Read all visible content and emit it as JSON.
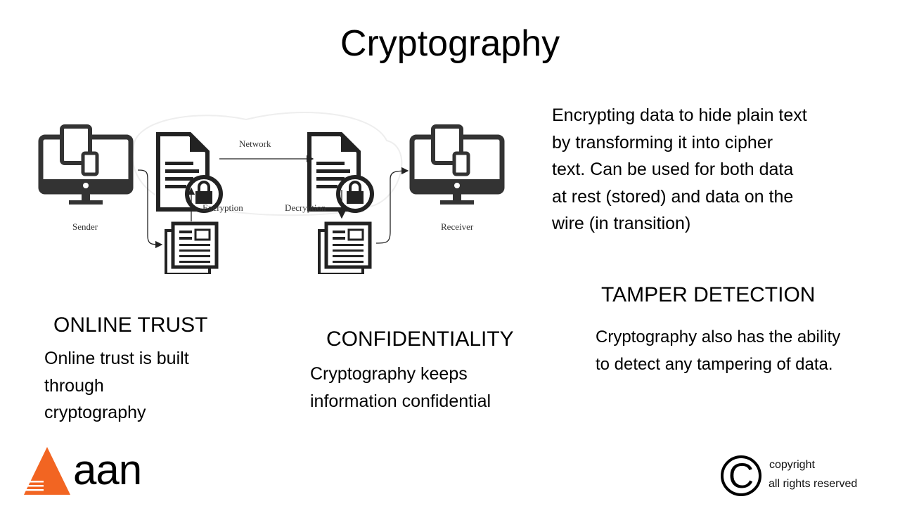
{
  "title": "Cryptography",
  "diagram": {
    "sender": "Sender",
    "receiver": "Receiver",
    "network": "Network",
    "encryption": "Encryption",
    "decryption": "Decryption"
  },
  "description": [
    "Encrypting data to hide plain text",
    "by transforming it into cipher",
    "text.  Can be used for both data",
    "at rest (stored) and data on the",
    "wire (in transition)"
  ],
  "online_trust": {
    "heading": "ONLINE TRUST",
    "lines": [
      "Online trust is built",
      "through",
      "cryptography"
    ]
  },
  "confidentiality": {
    "heading": "CONFIDENTIALITY",
    "lines": [
      "Cryptography keeps",
      "information confidential"
    ]
  },
  "tamper_detection": {
    "heading": "TAMPER DETECTION",
    "lines": [
      "Cryptography also has the ability",
      "to detect any tampering of data."
    ]
  },
  "logo": {
    "text": "aan",
    "color": "#f26522"
  },
  "copyright": {
    "symbol": "©",
    "line1": "copyright",
    "line2": "all rights reserved"
  }
}
